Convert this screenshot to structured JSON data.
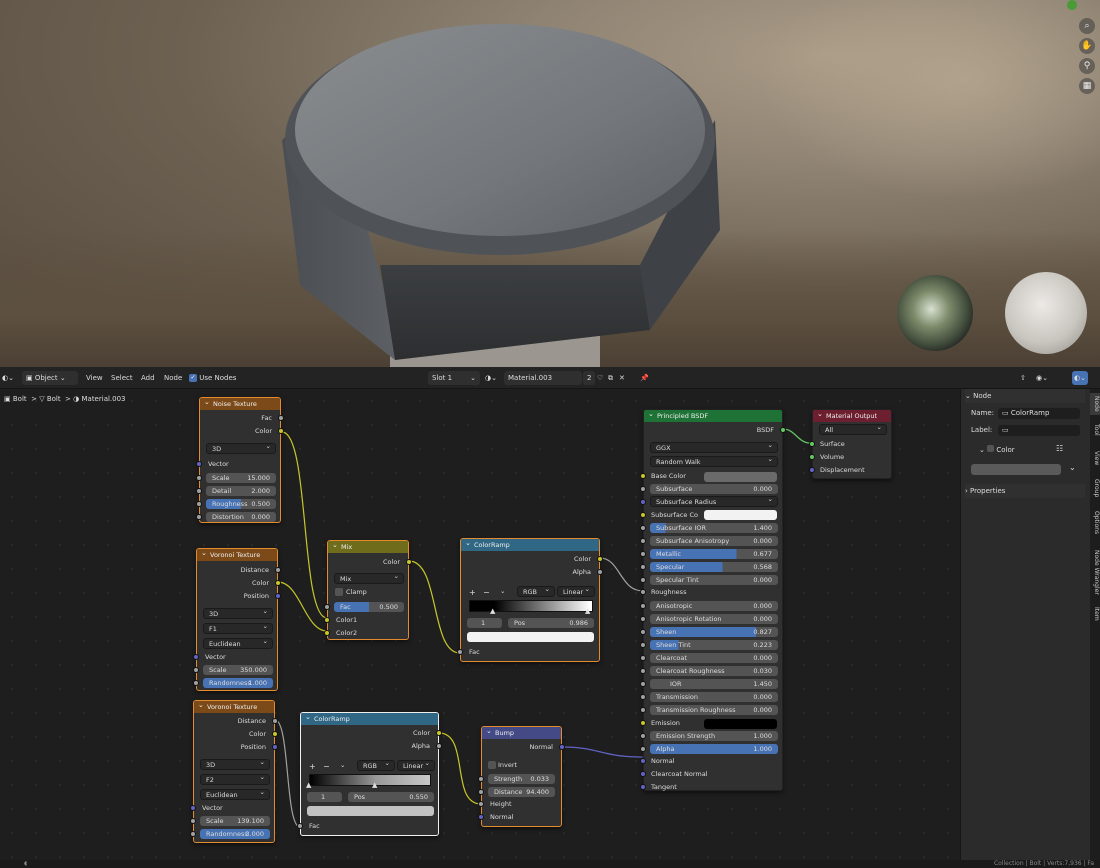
{
  "viewport": {
    "nav_icons": [
      "zoom-icon",
      "hand-pan-icon",
      "camera-icon",
      "grid-icon"
    ]
  },
  "toolbar": {
    "mode": "Object",
    "menu": [
      "View",
      "Select",
      "Add",
      "Node"
    ],
    "use_nodes_label": "Use Nodes",
    "slot": "Slot 1",
    "material_name": "Material.003",
    "users": "2"
  },
  "breadcrumb": {
    "object": "Bolt",
    "mesh": "Bolt",
    "material": "Material.003"
  },
  "nodes": {
    "noise": {
      "title": "Noise Texture",
      "out_fac": "Fac",
      "out_color": "Color",
      "dim": "3D",
      "vector": "Vector",
      "scale_l": "Scale",
      "scale_v": "15.000",
      "detail_l": "Detail",
      "detail_v": "2.000",
      "rough_l": "Roughness",
      "rough_v": "0.500",
      "dist_l": "Distortion",
      "dist_v": "0.000"
    },
    "voronoi1": {
      "title": "Voronoi Texture",
      "out_distance": "Distance",
      "out_color": "Color",
      "out_position": "Position",
      "dim": "3D",
      "feature": "F1",
      "metric": "Euclidean",
      "vector": "Vector",
      "scale_l": "Scale",
      "scale_v": "350.000",
      "rand_l": "Randomness",
      "rand_v": "1.000"
    },
    "mix": {
      "title": "Mix",
      "out_color": "Color",
      "mode": "Mix",
      "clamp": "Clamp",
      "fac_l": "Fac",
      "fac_v": "0.500",
      "in1": "Color1",
      "in2": "Color2"
    },
    "ramp1": {
      "title": "ColorRamp",
      "out_color": "Color",
      "out_alpha": "Alpha",
      "mode": "RGB",
      "interp": "Linear",
      "index": "1",
      "pos_l": "Pos",
      "pos_v": "0.986",
      "in_fac": "Fac"
    },
    "voronoi2": {
      "title": "Voronoi Texture",
      "out_distance": "Distance",
      "out_color": "Color",
      "out_position": "Position",
      "dim": "3D",
      "feature": "F2",
      "metric": "Euclidean",
      "vector": "Vector",
      "scale_l": "Scale",
      "scale_v": "139.100",
      "rand_l": "Randomness",
      "rand_v": "3.000"
    },
    "ramp2": {
      "title": "ColorRamp",
      "out_color": "Color",
      "out_alpha": "Alpha",
      "mode": "RGB",
      "interp": "Linear",
      "index": "1",
      "pos_l": "Pos",
      "pos_v": "0.550",
      "in_fac": "Fac"
    },
    "bump": {
      "title": "Bump",
      "out_normal": "Normal",
      "invert": "Invert",
      "strength_l": "Strength",
      "strength_v": "0.033",
      "distance_l": "Distance",
      "distance_v": "94.400",
      "in_height": "Height",
      "in_normal": "Normal"
    },
    "bsdf": {
      "title": "Principled BSDF",
      "out": "BSDF",
      "dist": "GGX",
      "sss": "Random Walk",
      "base_color": "Base Color",
      "subsurface_l": "Subsurface",
      "subsurface_v": "0.000",
      "sss_radius": "Subsurface Radius",
      "sss_color": "Subsurface Co",
      "sss_ior_l": "Subsurface IOR",
      "sss_ior_v": "1.400",
      "sss_aniso_l": "Subsurface Anisotropy",
      "sss_aniso_v": "0.000",
      "metallic_l": "Metallic",
      "metallic_v": "0.677",
      "specular_l": "Specular",
      "specular_v": "0.568",
      "spec_tint_l": "Specular Tint",
      "spec_tint_v": "0.000",
      "roughness": "Roughness",
      "aniso_l": "Anisotropic",
      "aniso_v": "0.000",
      "aniso_rot_l": "Anisotropic Rotation",
      "aniso_rot_v": "0.000",
      "sheen_l": "Sheen",
      "sheen_v": "0.827",
      "sheen_tint_l": "Sheen Tint",
      "sheen_tint_v": "0.223",
      "clearcoat_l": "Clearcoat",
      "clearcoat_v": "0.000",
      "cc_rough_l": "Clearcoat Roughness",
      "cc_rough_v": "0.030",
      "ior_l": "IOR",
      "ior_v": "1.450",
      "trans_l": "Transmission",
      "trans_v": "0.000",
      "trans_rough_l": "Transmission Roughness",
      "trans_rough_v": "0.000",
      "emission": "Emission",
      "em_strength_l": "Emission Strength",
      "em_strength_v": "1.000",
      "alpha_l": "Alpha",
      "alpha_v": "1.000",
      "normal": "Normal",
      "cc_normal": "Clearcoat Normal",
      "tangent": "Tangent"
    },
    "output": {
      "title": "Material Output",
      "target": "All",
      "surface": "Surface",
      "volume": "Volume",
      "displacement": "Displacement"
    }
  },
  "sidepanel": {
    "node_header": "Node",
    "name_label": "Name:",
    "name_value": "ColorRamp",
    "label_label": "Label:",
    "color_label": "Color",
    "properties_label": "Properties",
    "tabs": [
      "Node",
      "Tool",
      "View",
      "Group",
      "Options",
      "Node Wrangler",
      "Item"
    ]
  },
  "statusbar": {
    "text": "Collection | Bolt | Verts:7,936 | Fa"
  }
}
